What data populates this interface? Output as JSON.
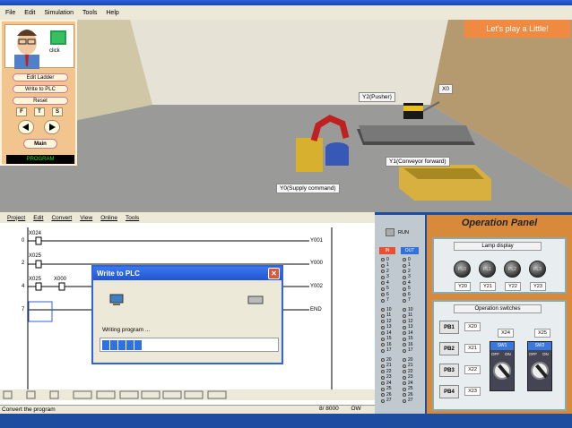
{
  "app": {
    "menu": [
      "File",
      "Edit",
      "Simulation",
      "Tools",
      "Help"
    ]
  },
  "control_panel": {
    "click_label": "click",
    "buttons": [
      "Edit Ladder",
      "Write to PLC",
      "Reset"
    ],
    "mode_keys": [
      "F",
      "T",
      "S"
    ],
    "main_label": "Main",
    "status": "PROGRAM"
  },
  "scene": {
    "play_button": "Let's play a Little!",
    "labels": {
      "y2": "Y2(Pusher)",
      "x0": "X0",
      "y1": "Y1(Conveyor forward)",
      "y0": "Y0(Supply command)"
    }
  },
  "editor": {
    "menu": [
      "Project",
      "Edit",
      "Convert",
      "View",
      "Online",
      "Tools"
    ],
    "rungs": [
      {
        "step": "0",
        "contacts": [
          "X024"
        ],
        "coil": "Y001"
      },
      {
        "step": "2",
        "contacts": [
          "X025"
        ],
        "coil": "Y000"
      },
      {
        "step": "4",
        "contacts": [
          "X025",
          "X000"
        ],
        "coil": "Y002"
      },
      {
        "step": "7",
        "contacts": [],
        "coil": "END"
      }
    ],
    "status_text": "Convert the program",
    "step_count": "8/ 8000",
    "mode": "OW"
  },
  "dialog": {
    "title": "Write to PLC",
    "message": "Writing program ...",
    "progress_blocks": 5
  },
  "io_monitor": {
    "run_label": "RUN",
    "in_label": "IN",
    "out_label": "OUT",
    "in_numbers": [
      "0",
      "1",
      "2",
      "3",
      "4",
      "5",
      "6",
      "7",
      "10",
      "11",
      "12",
      "13",
      "14",
      "15",
      "16",
      "17",
      "20",
      "21",
      "22",
      "23",
      "24",
      "25",
      "26",
      "27"
    ],
    "out_numbers": [
      "0",
      "1",
      "2",
      "3",
      "4",
      "5",
      "6",
      "7",
      "10",
      "11",
      "12",
      "13",
      "14",
      "15",
      "16",
      "17",
      "20",
      "21",
      "22",
      "23",
      "24",
      "25",
      "26",
      "27"
    ]
  },
  "operation_panel": {
    "title": "Operation Panel",
    "lamp_display_label": "Lamp display",
    "lamps": [
      {
        "text": "PL0",
        "y": "Y20"
      },
      {
        "text": "PL1",
        "y": "Y21"
      },
      {
        "text": "PL2",
        "y": "Y22"
      },
      {
        "text": "PL3",
        "y": "Y23"
      }
    ],
    "switches_label": "Operation switches",
    "push_buttons": [
      {
        "text": "PB1",
        "x": "X20"
      },
      {
        "text": "PB2",
        "x": "X21"
      },
      {
        "text": "PB3",
        "x": "X22"
      },
      {
        "text": "PB4",
        "x": "X23"
      }
    ],
    "selector_switches": [
      {
        "text": "SW1",
        "x": "X24",
        "off": "OFF",
        "on": "ON"
      },
      {
        "text": "SW2",
        "x": "X25",
        "off": "OFF",
        "on": "ON"
      }
    ]
  }
}
